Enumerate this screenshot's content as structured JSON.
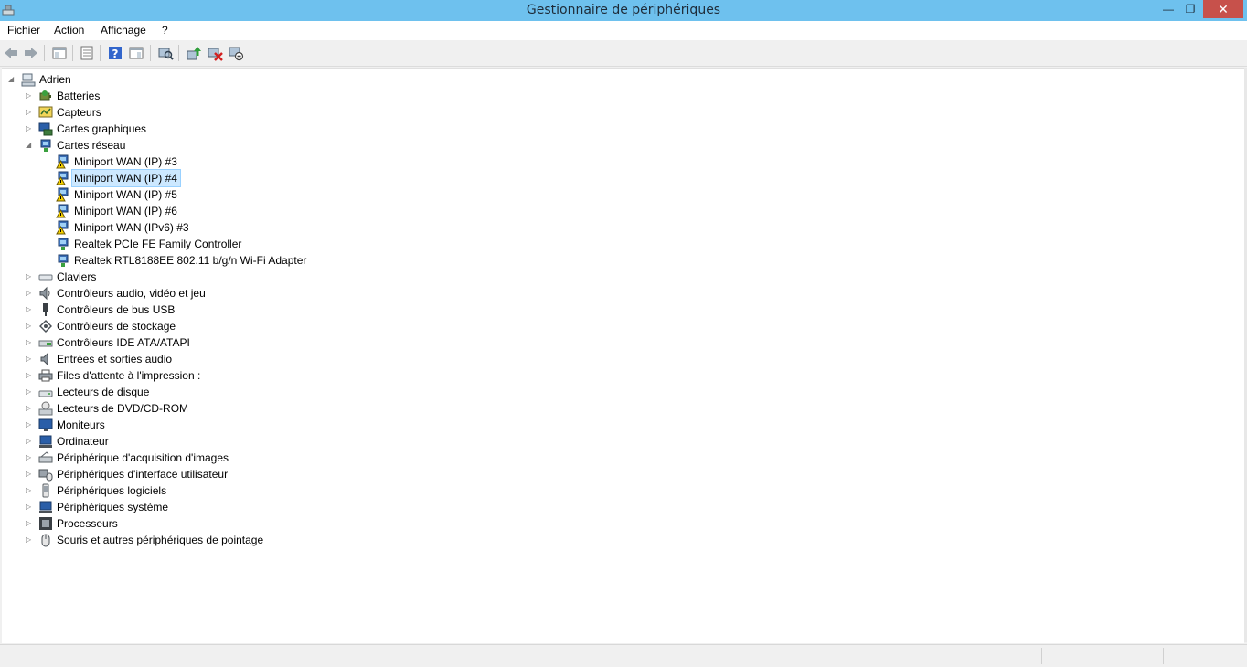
{
  "window": {
    "title": "Gestionnaire de périphériques"
  },
  "menu": [
    "Fichier",
    "Action",
    "Affichage",
    "?"
  ],
  "toolbar_icons": [
    "back-arrow-icon",
    "forward-arrow-icon",
    "show-hide-tree-icon",
    "properties-icon",
    "help-icon",
    "action-pane-icon",
    "scan-hardware-icon",
    "update-driver-icon",
    "uninstall-device-icon",
    "disable-device-icon"
  ],
  "tree": {
    "root": "Adrien",
    "categories": {
      "batteries": "Batteries",
      "capteurs": "Capteurs",
      "cartes_graphiques": "Cartes graphiques",
      "cartes_reseau": "Cartes réseau",
      "claviers": "Claviers",
      "audio_video_jeu": "Contrôleurs audio, vidéo et jeu",
      "bus_usb": "Contrôleurs de bus USB",
      "stockage": "Contrôleurs de stockage",
      "ide": "Contrôleurs IDE ATA/ATAPI",
      "entrees_sorties_audio": "Entrées et sorties audio",
      "impression": "Files d'attente à l'impression :",
      "lecteurs_disque": "Lecteurs de disque",
      "dvd": "Lecteurs de DVD/CD-ROM",
      "moniteurs": "Moniteurs",
      "ordinateur": "Ordinateur",
      "acquisition_images": "Périphérique d'acquisition d'images",
      "interface_utilisateur": "Périphériques d'interface utilisateur",
      "logiciels": "Périphériques logiciels",
      "systeme": "Périphériques système",
      "processeurs": "Processeurs",
      "souris": "Souris et autres périphériques de pointage"
    },
    "network_adapters": [
      {
        "label": "Miniport WAN (IP) #3",
        "warning": true,
        "selected": false
      },
      {
        "label": "Miniport WAN (IP) #4",
        "warning": true,
        "selected": true
      },
      {
        "label": "Miniport WAN (IP) #5",
        "warning": true,
        "selected": false
      },
      {
        "label": "Miniport WAN (IP) #6",
        "warning": true,
        "selected": false
      },
      {
        "label": "Miniport WAN (IPv6) #3",
        "warning": true,
        "selected": false
      },
      {
        "label": "Realtek PCIe FE Family Controller",
        "warning": false,
        "selected": false
      },
      {
        "label": "Realtek RTL8188EE 802.11 b/g/n Wi-Fi Adapter",
        "warning": false,
        "selected": false
      }
    ]
  },
  "colors": {
    "titlebar": "#6ec1ee",
    "close": "#c7514b",
    "selection": "#cce8ff",
    "warning": "#f5d000"
  }
}
